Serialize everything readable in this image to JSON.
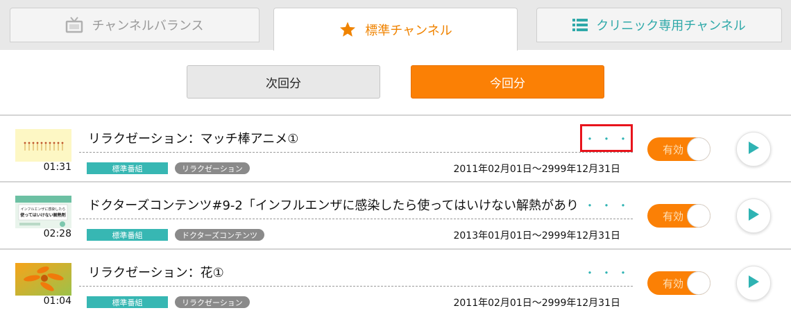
{
  "tabs": [
    {
      "label": "チャンネルバランス",
      "icon": "tv-icon",
      "state": "inactive"
    },
    {
      "label": "標準チャンネル",
      "icon": "star-icon",
      "state": "active"
    },
    {
      "label": "クリニック専用チャンネル",
      "icon": "list-icon",
      "state": "inactive"
    }
  ],
  "buttons": {
    "next": "次回分",
    "current": "今回分"
  },
  "colors": {
    "accent_orange": "#fb8005",
    "teal": "#37b7b3",
    "highlight_red": "#e8141c"
  },
  "items": [
    {
      "title": "リラクゼーション：マッチ棒アニメ①",
      "duration": "01:31",
      "genre": "標準番組",
      "category": "リラクゼーション",
      "period": "2011年02月01日～2999年12月31日",
      "more": "・・・",
      "toggle_label": "有効",
      "thumbnail": "matchsticks-thumbnail"
    },
    {
      "title": "ドクターズコンテンツ#9-2「インフルエンザに感染したら使ってはいけない解熱があり",
      "duration": "02:28",
      "genre": "標準番組",
      "category": "ドクターズコンテンツ",
      "period": "2013年01月01日～2999年12月31日",
      "more": "・・・",
      "toggle_label": "有効",
      "thumbnail": "doctors-thumbnail",
      "thumb_text": "インフルエンザに感染したら 使ってはいけない解熱剤"
    },
    {
      "title": "リラクゼーション：花①",
      "duration": "01:04",
      "genre": "標準番組",
      "category": "リラクゼーション",
      "period": "2011年02月01日～2999年12月31日",
      "more": "・・・",
      "toggle_label": "有効",
      "thumbnail": "flower-thumbnail"
    }
  ]
}
